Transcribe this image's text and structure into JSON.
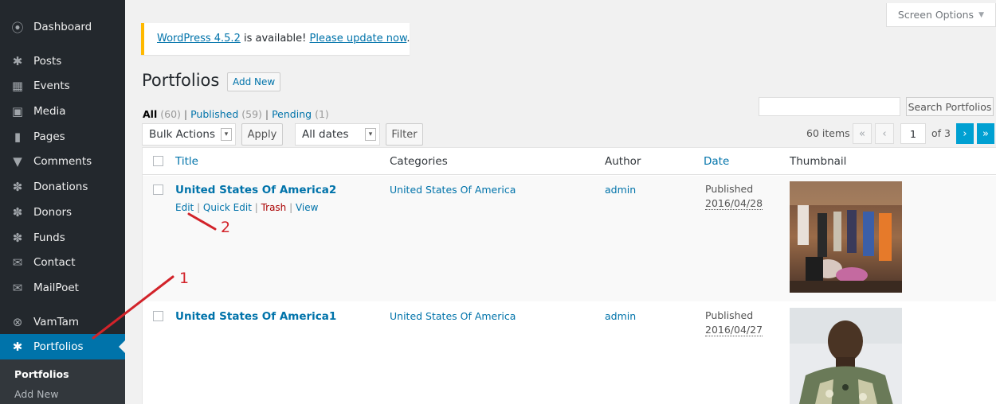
{
  "sidebar": {
    "items": [
      {
        "label": "Dashboard",
        "icon": "dashboard-icon",
        "glyph": "⦿"
      },
      {
        "label": "Posts",
        "icon": "pin-icon",
        "glyph": "✱"
      },
      {
        "label": "Events",
        "icon": "calendar-icon",
        "glyph": "▦"
      },
      {
        "label": "Media",
        "icon": "media-icon",
        "glyph": "▣"
      },
      {
        "label": "Pages",
        "icon": "pages-icon",
        "glyph": "▮"
      },
      {
        "label": "Comments",
        "icon": "comment-icon",
        "glyph": "▼"
      },
      {
        "label": "Donations",
        "icon": "palm-icon",
        "glyph": "✽"
      },
      {
        "label": "Donors",
        "icon": "palm-icon",
        "glyph": "✽"
      },
      {
        "label": "Funds",
        "icon": "palm-icon",
        "glyph": "✽"
      },
      {
        "label": "Contact",
        "icon": "mail-icon",
        "glyph": "✉"
      },
      {
        "label": "MailPoet",
        "icon": "mail-icon",
        "glyph": "✉"
      },
      {
        "label": "VamTam",
        "icon": "rings-icon",
        "glyph": "⊗"
      },
      {
        "label": "Portfolios",
        "icon": "pin-icon",
        "glyph": "✱"
      }
    ],
    "submenu": [
      "Portfolios",
      "Add New"
    ]
  },
  "header": {
    "screen_options": "Screen Options",
    "screen_options_caret": "▼"
  },
  "notice": {
    "version_link": "WordPress 4.5.2",
    "middle": " is available! ",
    "update_link": "Please update now",
    "end": "."
  },
  "page": {
    "title": "Portfolios",
    "add_new": "Add New"
  },
  "views": {
    "all": "All",
    "all_count": "(60)",
    "sep1": " | ",
    "published": "Published",
    "published_count": "(59)",
    "sep2": " | ",
    "pending": "Pending",
    "pending_count": "(1)"
  },
  "search": {
    "button": "Search Portfolios"
  },
  "toolbar": {
    "bulk_actions": "Bulk Actions",
    "apply": "Apply",
    "dates": "All dates",
    "filter": "Filter",
    "items_count": "60 items",
    "first": "«",
    "prev": "‹",
    "current_page": "1",
    "of_pages": "of 3",
    "next": "›",
    "last": "»"
  },
  "table": {
    "headers": {
      "title": "Title",
      "categories": "Categories",
      "author": "Author",
      "date": "Date",
      "thumbnail": "Thumbnail"
    },
    "rows": [
      {
        "title": "United States Of America2",
        "category": "United States Of America",
        "author": "admin",
        "status": "Published",
        "date": "2016/04/28",
        "actions": {
          "edit": "Edit",
          "quick_edit": "Quick Edit",
          "trash": "Trash",
          "view": "View",
          "sep": " | "
        }
      },
      {
        "title": "United States Of America1",
        "category": "United States Of America",
        "author": "admin",
        "status": "Published",
        "date": "2016/04/27"
      }
    ]
  },
  "annotations": {
    "one": "1",
    "two": "2",
    "color": "#d2232a"
  }
}
